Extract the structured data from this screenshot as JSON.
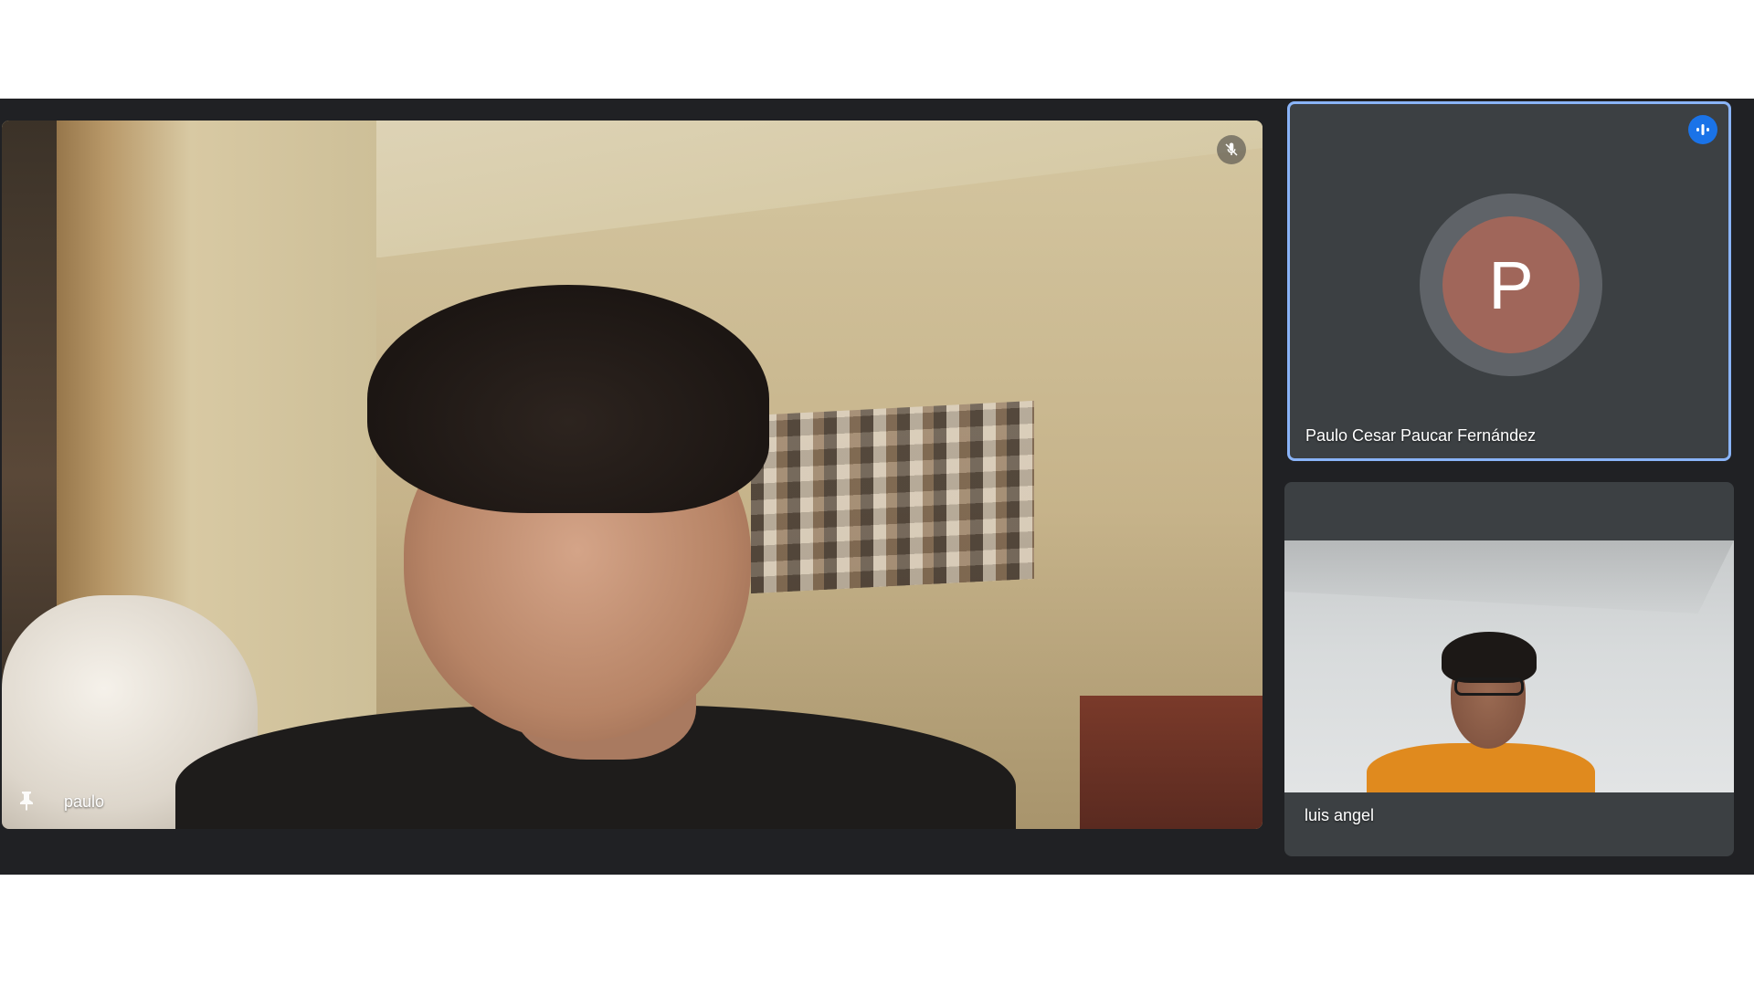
{
  "participants": {
    "main": {
      "name": "paulo",
      "mic_muted": true,
      "pinned": true
    },
    "avatar_tile": {
      "name": "Paulo Cesar Paucar Fernández",
      "initial": "P",
      "speaking": true
    },
    "video_tile": {
      "name": "luis angel"
    }
  },
  "colors": {
    "background": "#202124",
    "tile": "#3c4043",
    "active_speaker_border": "#8ab4f8",
    "speaking_badge": "#1a73e8",
    "avatar_fill": "#a0665a"
  },
  "icons": {
    "main_mic": "mic-off-icon",
    "main_pin": "pin-icon",
    "avatar_speaking": "audio-level-icon"
  }
}
